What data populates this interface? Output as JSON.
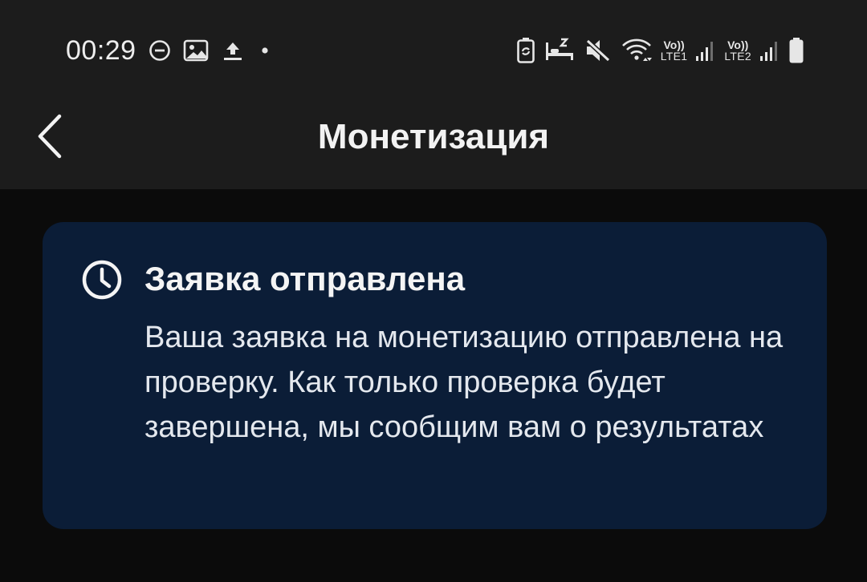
{
  "status_bar": {
    "time": "00:29",
    "left_icons": [
      "do-not-disturb-icon",
      "gallery-icon",
      "upload-icon",
      "notification-dot-icon"
    ],
    "right_icons": [
      "battery-saver-icon",
      "sleep-mode-icon",
      "mute-icon",
      "wifi-icon",
      "signal-sim1-icon",
      "signal-sim2-icon",
      "battery-icon"
    ],
    "sim1": {
      "vo": "Vo))",
      "lte": "LTE1"
    },
    "sim2": {
      "vo": "Vo))",
      "lte": "LTE2"
    }
  },
  "toolbar": {
    "title": "Монетизация",
    "back_icon": "chevron-left-icon"
  },
  "card": {
    "icon": "clock-icon",
    "title": "Заявка отправлена",
    "message": "Ваша заявка на монетизацию отправлена на проверку. Как только проверка будет завершена, мы сообщим вам о результатах"
  },
  "colors": {
    "page_background": "#0b0b0b",
    "header_background": "#1c1c1c",
    "card_background": "#0b1d37",
    "text_primary": "#ffffff"
  }
}
